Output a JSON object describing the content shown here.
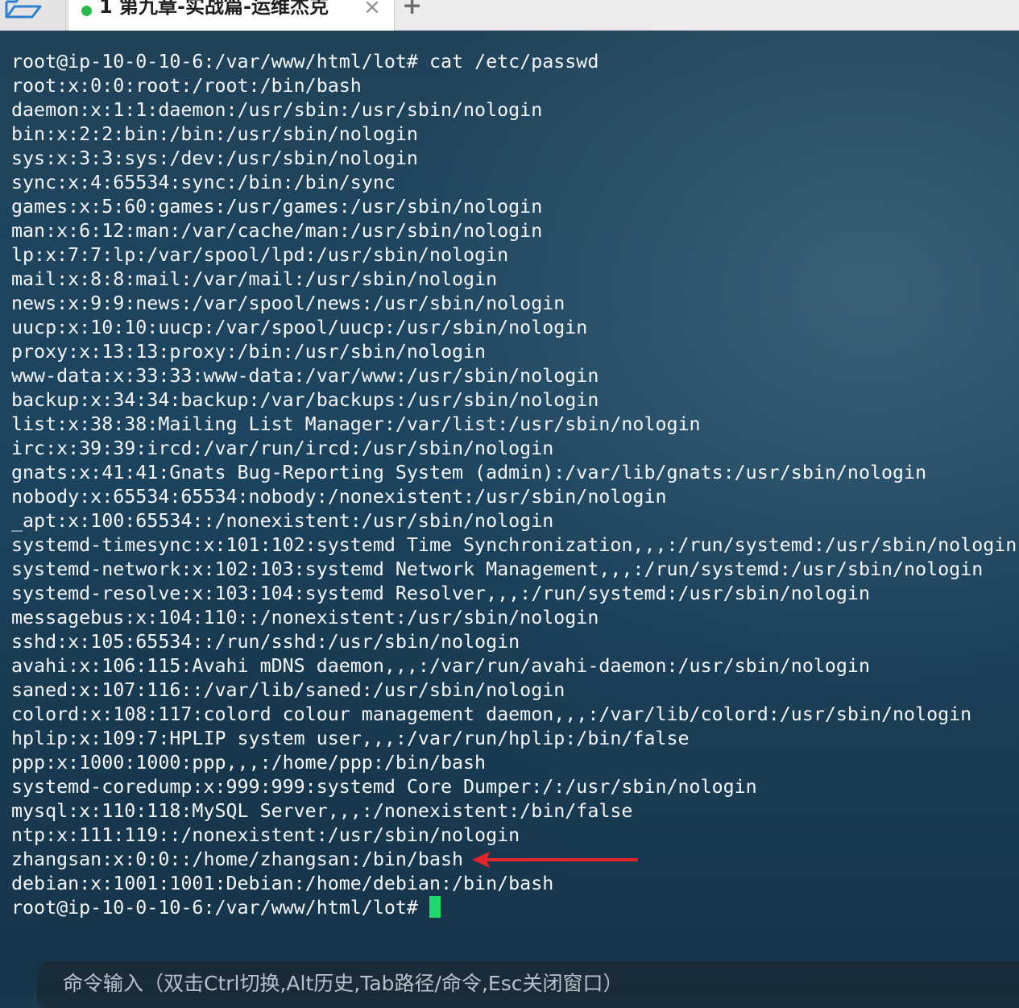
{
  "tabbar": {
    "folder_icon": "folder-icon",
    "active_tab": {
      "status_color": "#2bb84a",
      "title": "1 第九章-实战篇-运维杰克",
      "close_glyph": "×"
    },
    "add_glyph": "+"
  },
  "terminal": {
    "prompt": "root@ip-10-0-10-6:/var/www/html/lot#",
    "command": "cat /etc/passwd",
    "lines": [
      "root@ip-10-0-10-6:/var/www/html/lot# cat /etc/passwd",
      "root:x:0:0:root:/root:/bin/bash",
      "daemon:x:1:1:daemon:/usr/sbin:/usr/sbin/nologin",
      "bin:x:2:2:bin:/bin:/usr/sbin/nologin",
      "sys:x:3:3:sys:/dev:/usr/sbin/nologin",
      "sync:x:4:65534:sync:/bin:/bin/sync",
      "games:x:5:60:games:/usr/games:/usr/sbin/nologin",
      "man:x:6:12:man:/var/cache/man:/usr/sbin/nologin",
      "lp:x:7:7:lp:/var/spool/lpd:/usr/sbin/nologin",
      "mail:x:8:8:mail:/var/mail:/usr/sbin/nologin",
      "news:x:9:9:news:/var/spool/news:/usr/sbin/nologin",
      "uucp:x:10:10:uucp:/var/spool/uucp:/usr/sbin/nologin",
      "proxy:x:13:13:proxy:/bin:/usr/sbin/nologin",
      "www-data:x:33:33:www-data:/var/www:/usr/sbin/nologin",
      "backup:x:34:34:backup:/var/backups:/usr/sbin/nologin",
      "list:x:38:38:Mailing List Manager:/var/list:/usr/sbin/nologin",
      "irc:x:39:39:ircd:/var/run/ircd:/usr/sbin/nologin",
      "gnats:x:41:41:Gnats Bug-Reporting System (admin):/var/lib/gnats:/usr/sbin/nologin",
      "nobody:x:65534:65534:nobody:/nonexistent:/usr/sbin/nologin",
      "_apt:x:100:65534::/nonexistent:/usr/sbin/nologin",
      "systemd-timesync:x:101:102:systemd Time Synchronization,,,:/run/systemd:/usr/sbin/nologin",
      "systemd-network:x:102:103:systemd Network Management,,,:/run/systemd:/usr/sbin/nologin",
      "systemd-resolve:x:103:104:systemd Resolver,,,:/run/systemd:/usr/sbin/nologin",
      "messagebus:x:104:110::/nonexistent:/usr/sbin/nologin",
      "sshd:x:105:65534::/run/sshd:/usr/sbin/nologin",
      "avahi:x:106:115:Avahi mDNS daemon,,,:/var/run/avahi-daemon:/usr/sbin/nologin",
      "saned:x:107:116::/var/lib/saned:/usr/sbin/nologin",
      "colord:x:108:117:colord colour management daemon,,,:/var/lib/colord:/usr/sbin/nologin",
      "hplip:x:109:7:HPLIP system user,,,:/var/run/hplip:/bin/false",
      "ppp:x:1000:1000:ppp,,,:/home/ppp:/bin/bash",
      "systemd-coredump:x:999:999:systemd Core Dumper:/:/usr/sbin/nologin",
      "mysql:x:110:118:MySQL Server,,,:/nonexistent:/bin/false",
      "ntp:x:111:119::/nonexistent:/usr/sbin/nologin",
      "zhangsan:x:0:0::/home/zhangsan:/bin/bash",
      "debian:x:1001:1001:Debian:/home/debian:/bin/bash"
    ],
    "final_prompt": "root@ip-10-0-10-6:/var/www/html/lot#",
    "cursor_color": "#1fd86b",
    "annotation_arrow_color": "#e3262b"
  },
  "command_bar": {
    "label": "命令输入（双击Ctrl切换,Alt历史,Tab路径/命令,Esc关闭窗口）"
  }
}
